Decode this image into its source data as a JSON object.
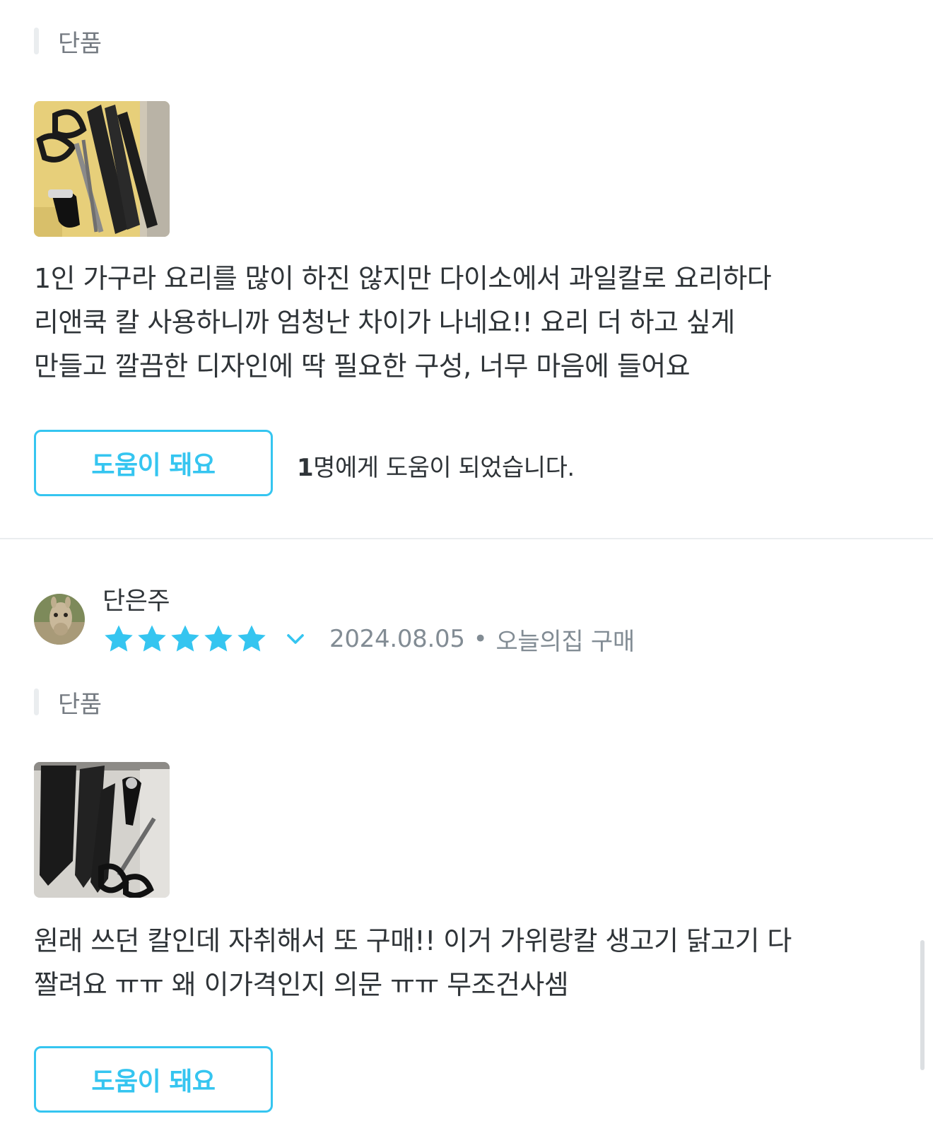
{
  "reviews": [
    {
      "option_label": "단품",
      "photo_icon": "knife-set-photo-yellow-board",
      "text": "1인 가구라 요리를 많이 하진 않지만 다이소에서 과일칼로 요리하다\n리앤쿡 칼 사용하니까 엄청난 차이가 나네요!! 요리 더 하고 싶게\n만들고 깔끔한 디자인에 딱 필요한 구성, 너무 마음에 들어요",
      "help_button_label": "도움이 돼요",
      "help_count_number": "1",
      "help_count_suffix": "명에게 도움이 되었습니다."
    },
    {
      "author": "단은주",
      "avatar_icon": "alpaca-avatar",
      "rating": 5,
      "rating_max": 5,
      "date": "2024.08.05",
      "separator": "•",
      "source": "오늘의집 구매",
      "option_label": "단품",
      "photo_icon": "knife-set-photo-white-box",
      "text": "원래 쓰던 칼인데 자취해서 또 구매!! 이거 가위랑칼 생고기 닭고기 다\n짤려요 ㅠㅠ 왜 이가격인지 의문 ㅠㅠ 무조건사셈",
      "help_button_label": "도움이 돼요"
    }
  ],
  "colors": {
    "accent": "#35c5f0",
    "text": "#2f3438",
    "muted": "#828c94",
    "divider": "#eaedef"
  }
}
